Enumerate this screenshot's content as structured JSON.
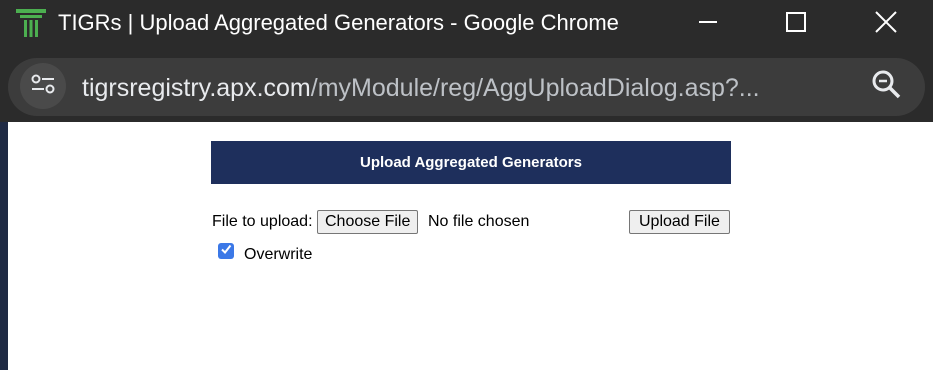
{
  "window": {
    "title": "TIGRs | Upload Aggregated Generators - Google Chrome",
    "icon": "tigrs-logo-icon",
    "accent_color": "#4caf50"
  },
  "omnibox": {
    "url_host": "tigrsregistry.apx.com",
    "url_path": "/myModule/reg/AggUploadDialog.asp?..."
  },
  "page": {
    "header": "Upload Aggregated Generators",
    "header_color": "#1e2f5c",
    "file_label": "File to upload:",
    "choose_file_label": "Choose File",
    "no_file_text": "No file chosen",
    "upload_button_label": "Upload File",
    "overwrite_label": "Overwrite",
    "overwrite_checked": true
  }
}
